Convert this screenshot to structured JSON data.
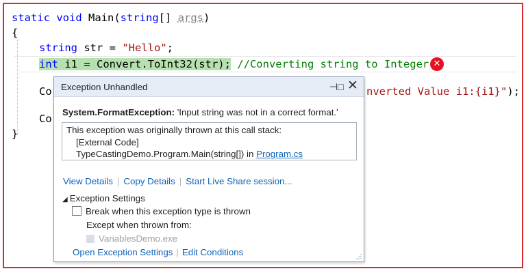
{
  "code": {
    "line1": {
      "kw1": "static",
      "kw2": "void",
      "rest": " Main(",
      "kw3": "string",
      "rest2": "[] ",
      "param": "args",
      "end": ")"
    },
    "line2": "{",
    "line3": {
      "kw": "string",
      "mid": " str = ",
      "str": "\"Hello\"",
      "end": ";"
    },
    "line4": {
      "kw": "int",
      "hl_rest": " i1 = Convert.ToInt32(str);",
      "comment": " //Converting string to Integer"
    },
    "line5_prefix": "Co",
    "line5_tail": {
      "str": "nverted Value i1:{i1}\"",
      "end": ");"
    },
    "line6_prefix": "Co",
    "line7": "}"
  },
  "error_icon": {
    "name": "error-icon",
    "glyph": "✕",
    "color": "#e81123"
  },
  "popup": {
    "title": "Exception Unhandled",
    "pin_glyph": "⊣□",
    "close_glyph": "✕",
    "exception_type": "System.FormatException:",
    "exception_message": " 'Input string was not in a correct format.'",
    "stack_header": "This exception was originally thrown at this call stack:",
    "stack_line1": "[External Code]",
    "stack_line2": "TypeCastingDemo.Program.Main(string[]) in ",
    "stack_link": "Program.cs",
    "actions": [
      "View Details",
      "Copy Details",
      "Start Live Share session..."
    ],
    "settings_toggle": "Exception Settings",
    "checkbox_label": "Break when this exception type is thrown",
    "except_label": "Except when thrown from:",
    "module": "VariablesDemo.exe",
    "bottom_links": [
      "Open Exception Settings",
      "Edit Conditions"
    ]
  },
  "colors": {
    "frame": "#e0262b",
    "keyword": "#0000ff",
    "string": "#a31515",
    "comment": "#008000",
    "link": "#0e62b8",
    "highlight": "#b7e0b0"
  }
}
